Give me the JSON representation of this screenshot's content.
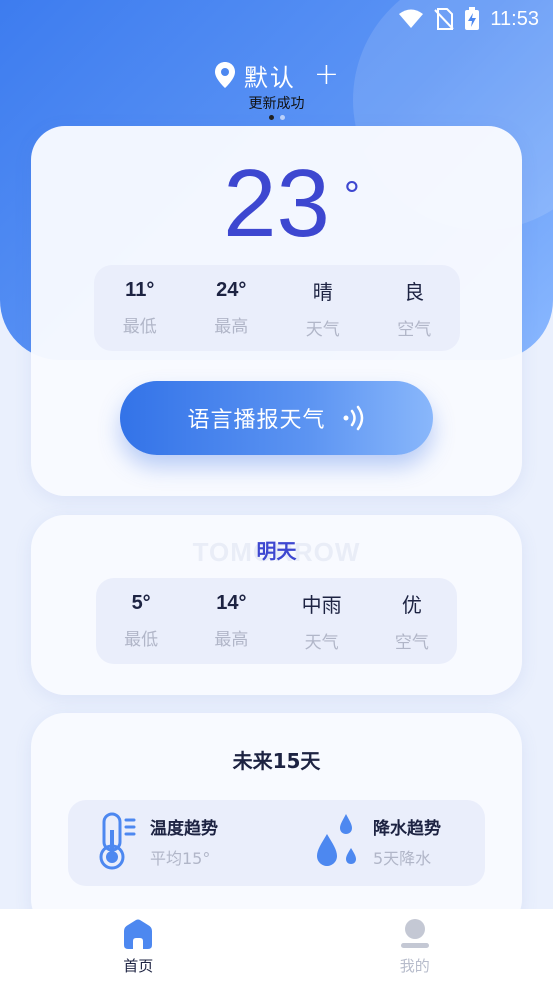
{
  "status_bar": {
    "time": "11:53"
  },
  "location": {
    "name": "默认",
    "add_symbol": "+"
  },
  "toast": "更新成功",
  "today": {
    "temperature": "23",
    "degree_symbol": "°",
    "stats": [
      {
        "value": "11°",
        "label": "最低"
      },
      {
        "value": "24°",
        "label": "最高"
      },
      {
        "value": "晴",
        "label": "天气"
      },
      {
        "value": "良",
        "label": "空气"
      }
    ],
    "voice_button_label": "语言播报天气"
  },
  "tomorrow": {
    "watermark": "TOMORROW",
    "title": "明天",
    "stats": [
      {
        "value": "5°",
        "label": "最低"
      },
      {
        "value": "14°",
        "label": "最高"
      },
      {
        "value": "中雨",
        "label": "天气"
      },
      {
        "value": "优",
        "label": "空气"
      }
    ]
  },
  "forecast": {
    "title": "未来15天",
    "temperature_trend": {
      "name": "温度趋势",
      "sub": "平均15°"
    },
    "rain_trend": {
      "name": "降水趋势",
      "sub": "5天降水"
    }
  },
  "tabs": [
    {
      "label": "首页",
      "active": true
    },
    {
      "label": "我的",
      "active": false
    }
  ],
  "colors": {
    "accent": "#3d47d0",
    "primary_blue": "#3d7cef",
    "light_blue": "#8ab8ff",
    "stat_bg": "#eaeefb",
    "muted_text": "#b1b6c8"
  }
}
